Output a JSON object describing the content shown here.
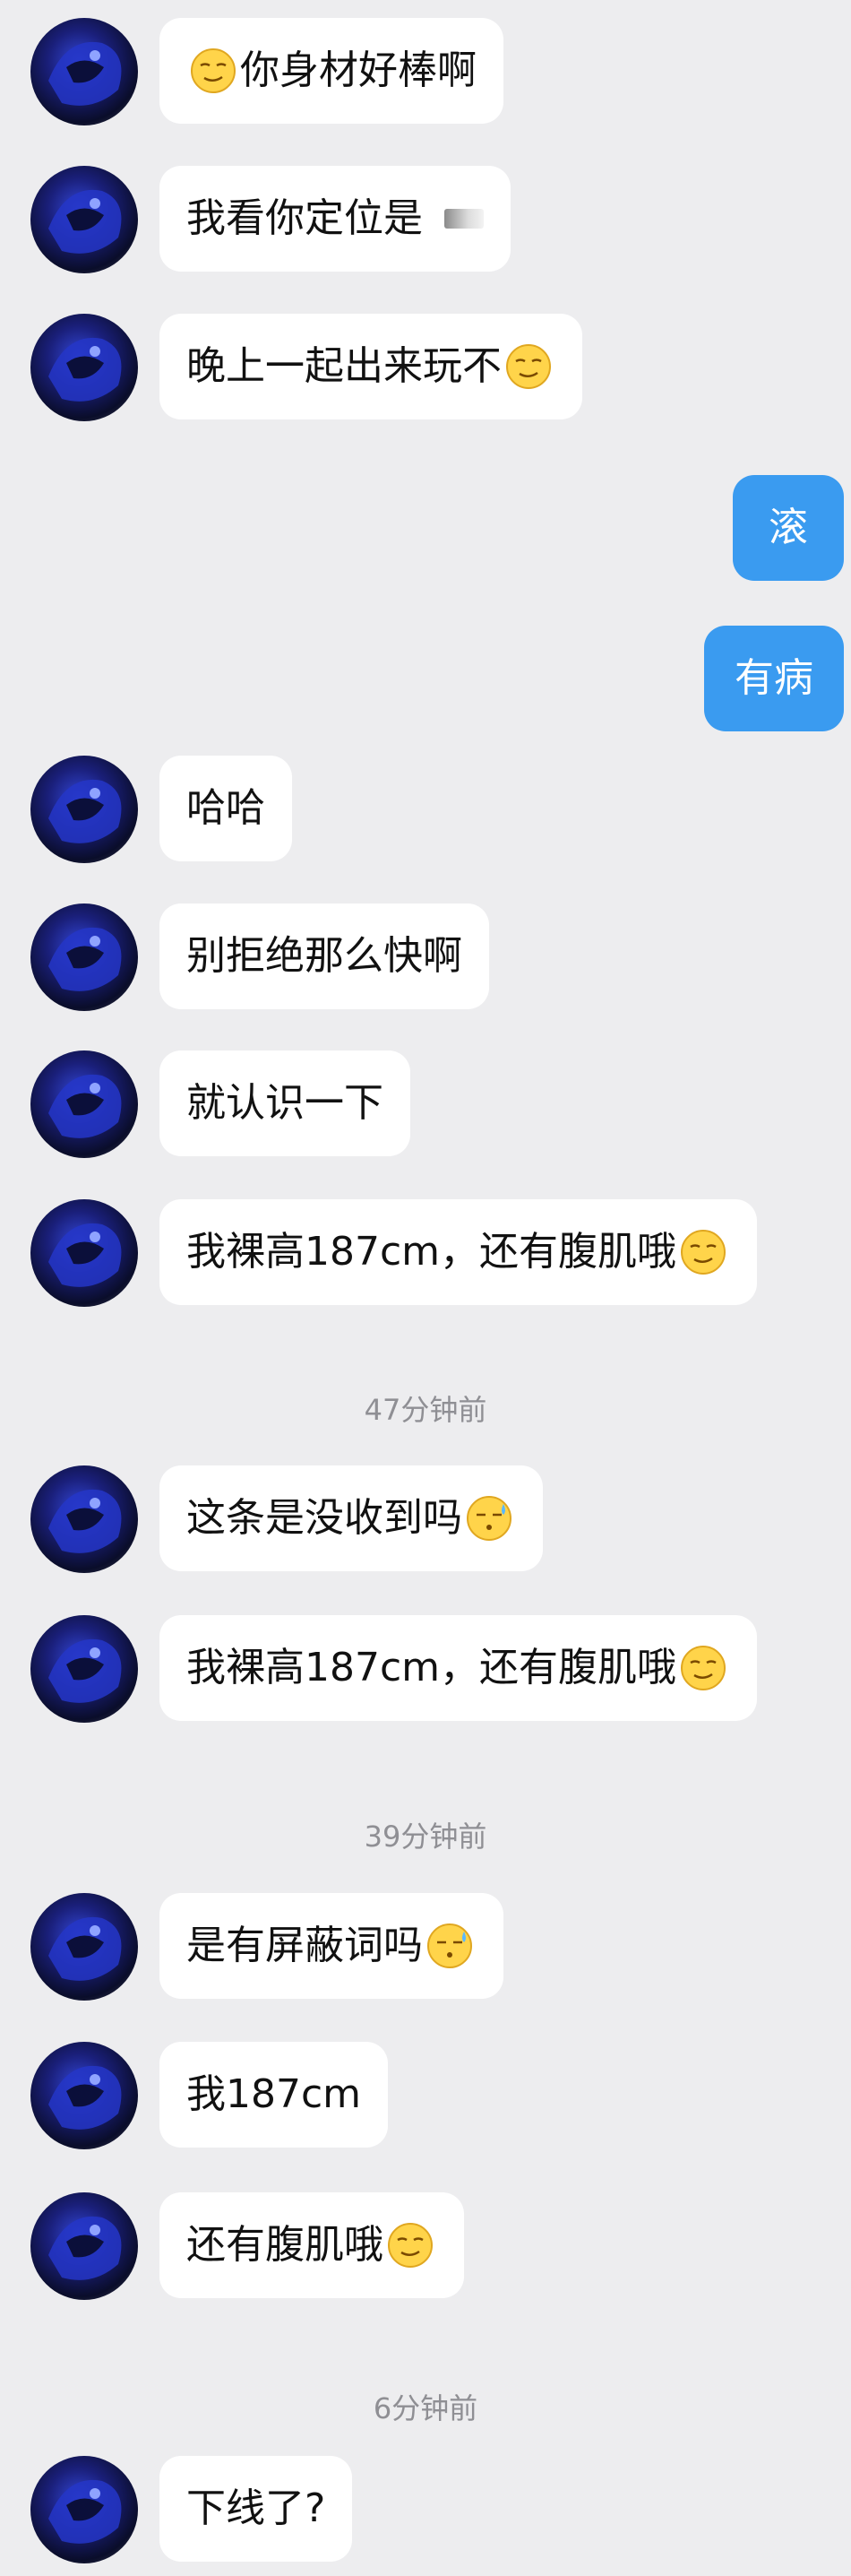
{
  "messages": [
    {
      "side": "left",
      "text": "你身材好棒啊",
      "emoji_before": true,
      "emoji_after": false
    },
    {
      "side": "left",
      "text": "我看你定位是",
      "redacted": true
    },
    {
      "side": "left",
      "text": "晚上一起出来玩不",
      "emoji_after": true
    },
    {
      "side": "right",
      "text": "滚"
    },
    {
      "side": "right",
      "text": "有病"
    },
    {
      "side": "left",
      "text": "哈哈"
    },
    {
      "side": "left",
      "text": "别拒绝那么快啊"
    },
    {
      "side": "left",
      "text": "就认识一下"
    },
    {
      "side": "left",
      "text": "我裸高187cm，还有腹肌哦",
      "emoji_after": true
    },
    {
      "timestamp": "47分钟前"
    },
    {
      "side": "left",
      "text": "这条是没收到吗",
      "emoji_after": true,
      "emoji_type": "sweat"
    },
    {
      "side": "left",
      "text": "我裸高187cm，还有腹肌哦",
      "emoji_after": true
    },
    {
      "timestamp": "39分钟前"
    },
    {
      "side": "left",
      "text": "是有屏蔽词吗",
      "emoji_after": true,
      "emoji_type": "sweat"
    },
    {
      "side": "left",
      "text": "我187cm"
    },
    {
      "side": "left",
      "text": "还有腹肌哦",
      "emoji_after": true
    },
    {
      "timestamp": "6分钟前"
    },
    {
      "side": "left",
      "text": "下线了?"
    }
  ],
  "colors": {
    "background": "#ededef",
    "incoming_bubble": "#ffffff",
    "outgoing_bubble": "#3a9bf0",
    "timestamp_text": "#8f8f94"
  },
  "icons": {
    "avatar": "contact-avatar",
    "smirk": "smirk-emoji-icon",
    "sweat": "sweat-emoji-icon"
  }
}
